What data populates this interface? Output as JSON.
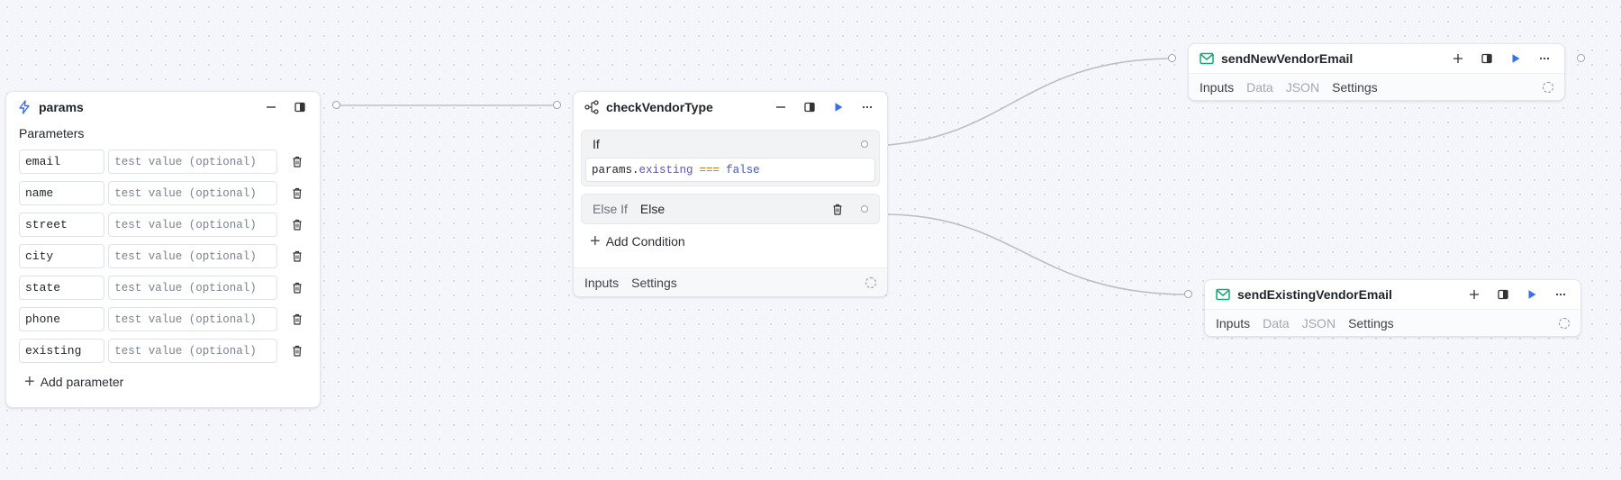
{
  "params_node": {
    "title": "params",
    "section_label": "Parameters",
    "params": [
      {
        "name": "email",
        "placeholder": "test value (optional)"
      },
      {
        "name": "name",
        "placeholder": "test value (optional)"
      },
      {
        "name": "street",
        "placeholder": "test value (optional)"
      },
      {
        "name": "city",
        "placeholder": "test value (optional)"
      },
      {
        "name": "state",
        "placeholder": "test value (optional)"
      },
      {
        "name": "phone",
        "placeholder": "test value (optional)"
      },
      {
        "name": "existing",
        "placeholder": "test value (optional)"
      }
    ],
    "add_label": "Add parameter"
  },
  "check_node": {
    "title": "checkVendorType",
    "if_label": "If",
    "condition": {
      "obj": "params",
      "dot": ".",
      "prop": "existing",
      "op": "===",
      "val": "false"
    },
    "elseif_label": "Else If",
    "else_label": "Else",
    "add_condition_label": "Add Condition",
    "tabs": [
      "Inputs",
      "Settings"
    ]
  },
  "new_email_node": {
    "title": "sendNewVendorEmail",
    "tabs": [
      "Inputs",
      "Data",
      "JSON",
      "Settings"
    ]
  },
  "existing_email_node": {
    "title": "sendExistingVendorEmail",
    "tabs": [
      "Inputs",
      "Data",
      "JSON",
      "Settings"
    ]
  },
  "colors": {
    "accent_blue": "#3b6fe8",
    "email_green": "#17a673",
    "code_keyword": "#5a4fd1",
    "code_operator": "#c7731c",
    "edge": "#b9bfca"
  }
}
